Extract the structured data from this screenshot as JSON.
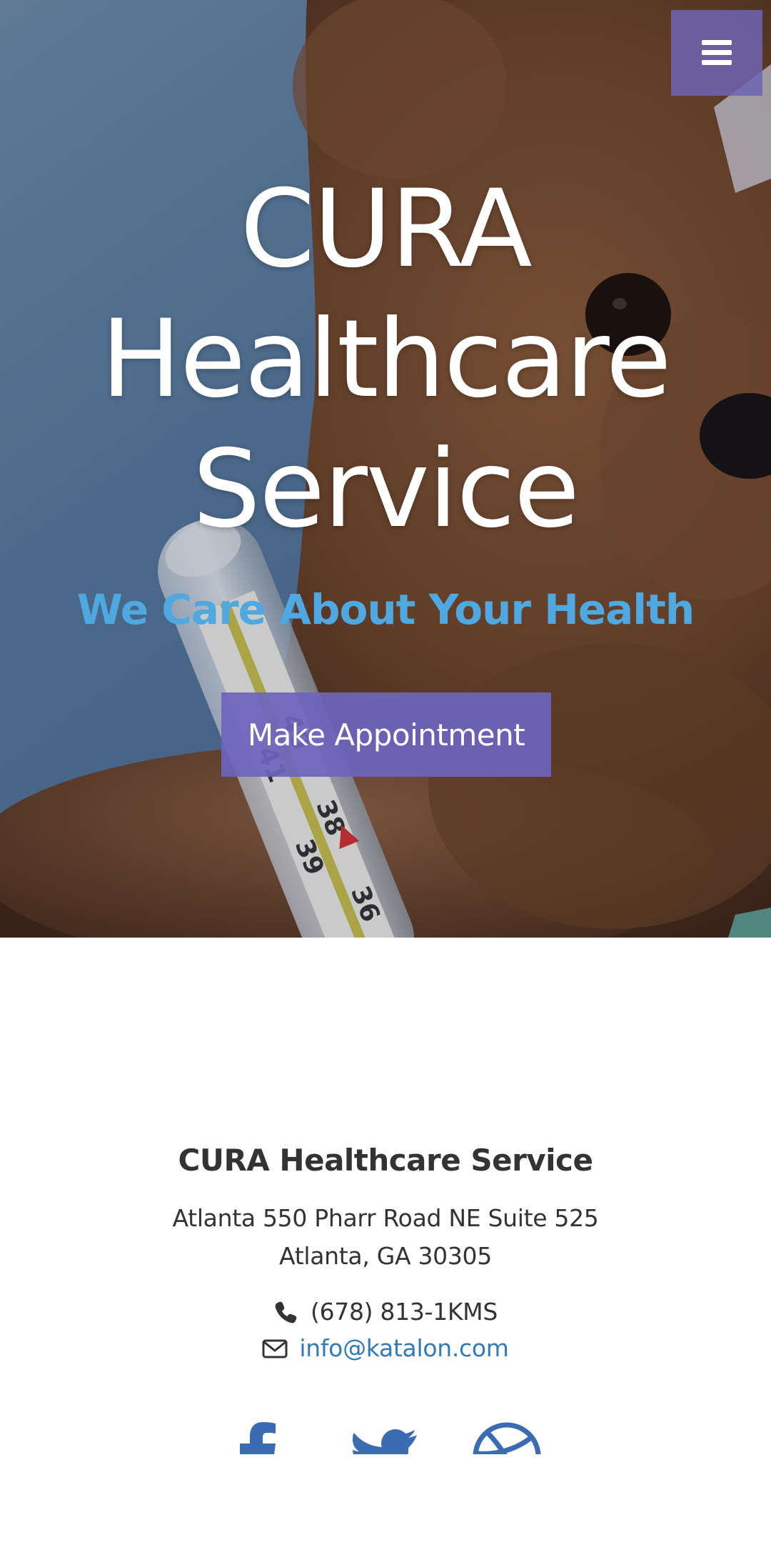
{
  "hero": {
    "title_line1": "CURA",
    "title_line2": "Healthcare",
    "title_line3": "Service",
    "subtitle": "We Care About Your Health",
    "cta_label": "Make Appointment"
  },
  "nav": {
    "menu_icon": "hamburger-menu-icon"
  },
  "footer": {
    "title": "CURA Healthcare Service",
    "address_line1": "Atlanta 550 Pharr Road NE Suite 525",
    "address_line2": "Atlanta, GA 30305",
    "phone": "(678) 813-1KMS",
    "email": "info@katalon.com",
    "social_icons": [
      "facebook-icon",
      "twitter-icon",
      "dribbble-icon"
    ]
  },
  "colors": {
    "accent_purple": "#6e64be",
    "subtitle_blue": "#4fa9e0",
    "link_blue": "#337ab7",
    "text_dark": "#333333",
    "social_blue": "#3b6bb0"
  }
}
